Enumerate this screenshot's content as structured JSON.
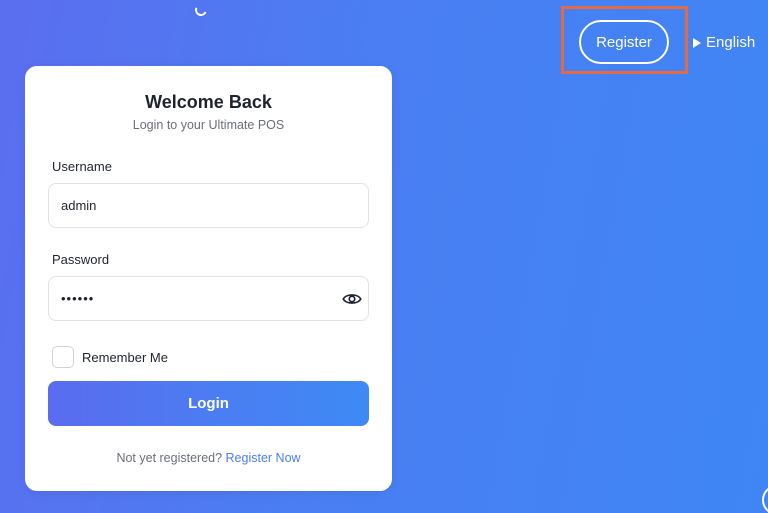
{
  "header": {
    "register_label": "Register",
    "language_label": "English"
  },
  "card": {
    "title": "Welcome Back",
    "subtitle": "Login to your Ultimate POS",
    "username_label": "Username",
    "username_value": "admin",
    "password_label": "Password",
    "password_value": "••••••",
    "remember_label": "Remember Me",
    "login_label": "Login",
    "footer_text": "Not yet registered?",
    "footer_link": "Register Now"
  },
  "colors": {
    "accent": "#4a7ef2",
    "highlight": "#e46a44"
  }
}
